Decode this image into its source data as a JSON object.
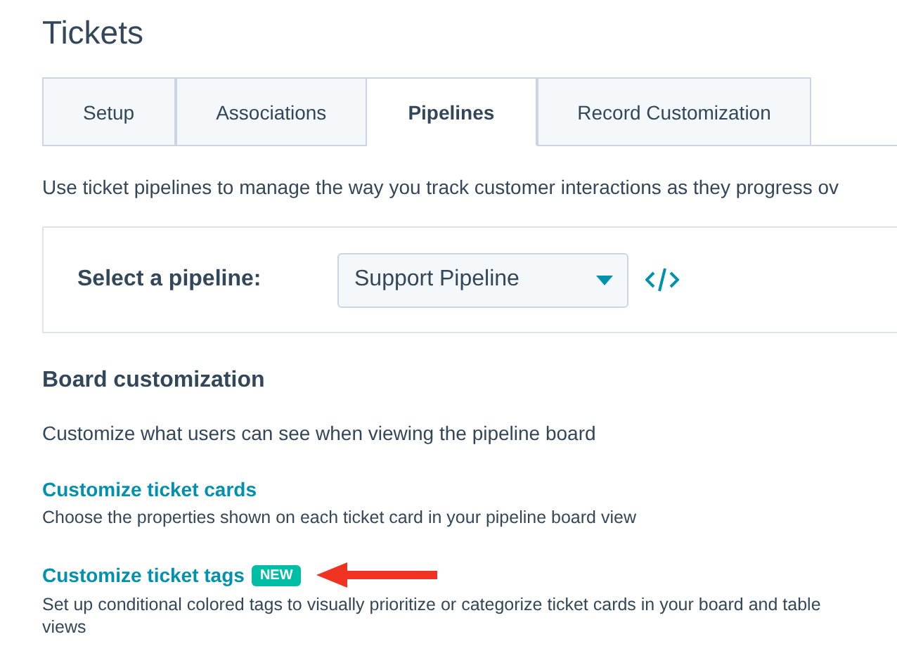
{
  "page_title": "Tickets",
  "tabs": [
    {
      "label": "Setup",
      "selected": false
    },
    {
      "label": "Associations",
      "selected": false
    },
    {
      "label": "Pipelines",
      "selected": true
    },
    {
      "label": "Record Customization",
      "selected": false
    }
  ],
  "intro": "Use ticket pipelines to manage the way you track customer interactions as they progress ov",
  "pipeline_selector": {
    "label": "Select a pipeline:",
    "value": "Support Pipeline"
  },
  "board_customization": {
    "heading": "Board customization",
    "description": "Customize what users can see when viewing the pipeline board",
    "links": [
      {
        "title": "Customize ticket cards",
        "highlighted": false,
        "description": "Choose the properties shown on each ticket card in your pipeline board view"
      },
      {
        "title": "Customize ticket tags",
        "badge": "NEW",
        "highlighted": true,
        "description": "Set up conditional colored tags to visually prioritize or categorize ticket cards in your board and table views"
      }
    ]
  }
}
